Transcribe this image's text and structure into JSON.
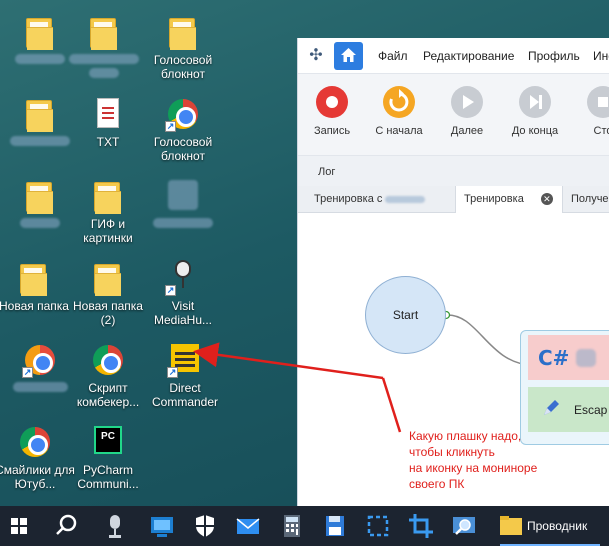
{
  "desktop": {
    "icons": [
      {
        "label": "",
        "kind": "folder-icon"
      },
      {
        "label": "",
        "kind": "folder-icon"
      },
      {
        "label": "Голосовой блокнот",
        "kind": "folder-icon"
      },
      {
        "label": "",
        "kind": "folder-icon"
      },
      {
        "label": "TXT",
        "kind": "text-file-icon"
      },
      {
        "label": "Голосовой блокнот",
        "kind": "chrome-icon"
      },
      {
        "label": "",
        "kind": "folder-icon"
      },
      {
        "label": "ГИФ и картинки",
        "kind": "folder-icon"
      },
      {
        "label": "",
        "kind": "app-icon"
      },
      {
        "label": "Новая папка",
        "kind": "folder-icon"
      },
      {
        "label": "Новая папка (2)",
        "kind": "folder-icon"
      },
      {
        "label": "Visit MediaHu...",
        "kind": "microphone-icon"
      },
      {
        "label": "",
        "kind": "app-icon"
      },
      {
        "label": "Скрипт комбекер...",
        "kind": "chrome-icon"
      },
      {
        "label": "Direct Commander",
        "kind": "direct-commander-icon"
      },
      {
        "label": "Смайлики для Ютуб...",
        "kind": "chrome-icon"
      },
      {
        "label": "PyCharm Communi...",
        "kind": "pycharm-icon"
      }
    ]
  },
  "app": {
    "menu": [
      "Файл",
      "Редактирование",
      "Профиль",
      "Инс"
    ],
    "toolbar": {
      "record": "Запись",
      "restart": "С начала",
      "next": "Далее",
      "to_end": "До конца",
      "stop": "Сто"
    },
    "log_label": "Лог",
    "tabs": [
      {
        "label": "Тренировка с"
      },
      {
        "label": "Тренировка",
        "active": true
      },
      {
        "label": "Получе"
      }
    ],
    "tab_close_glyph": "✕",
    "canvas": {
      "start_label": "Start",
      "csharp_label": "C#",
      "escape_label": "Escap"
    }
  },
  "annotation": {
    "lines": [
      "Какую плашку надо,",
      "чтобы кликнуть",
      "на иконку на мониноре",
      "своего ПК"
    ],
    "color": "#e0201c"
  },
  "taskbar": {
    "explorer_label": "Проводник"
  },
  "colors": {
    "accent": "#2d7de0",
    "record": "#e53935",
    "restart": "#f5a623",
    "disabled": "#c8ccd2"
  }
}
